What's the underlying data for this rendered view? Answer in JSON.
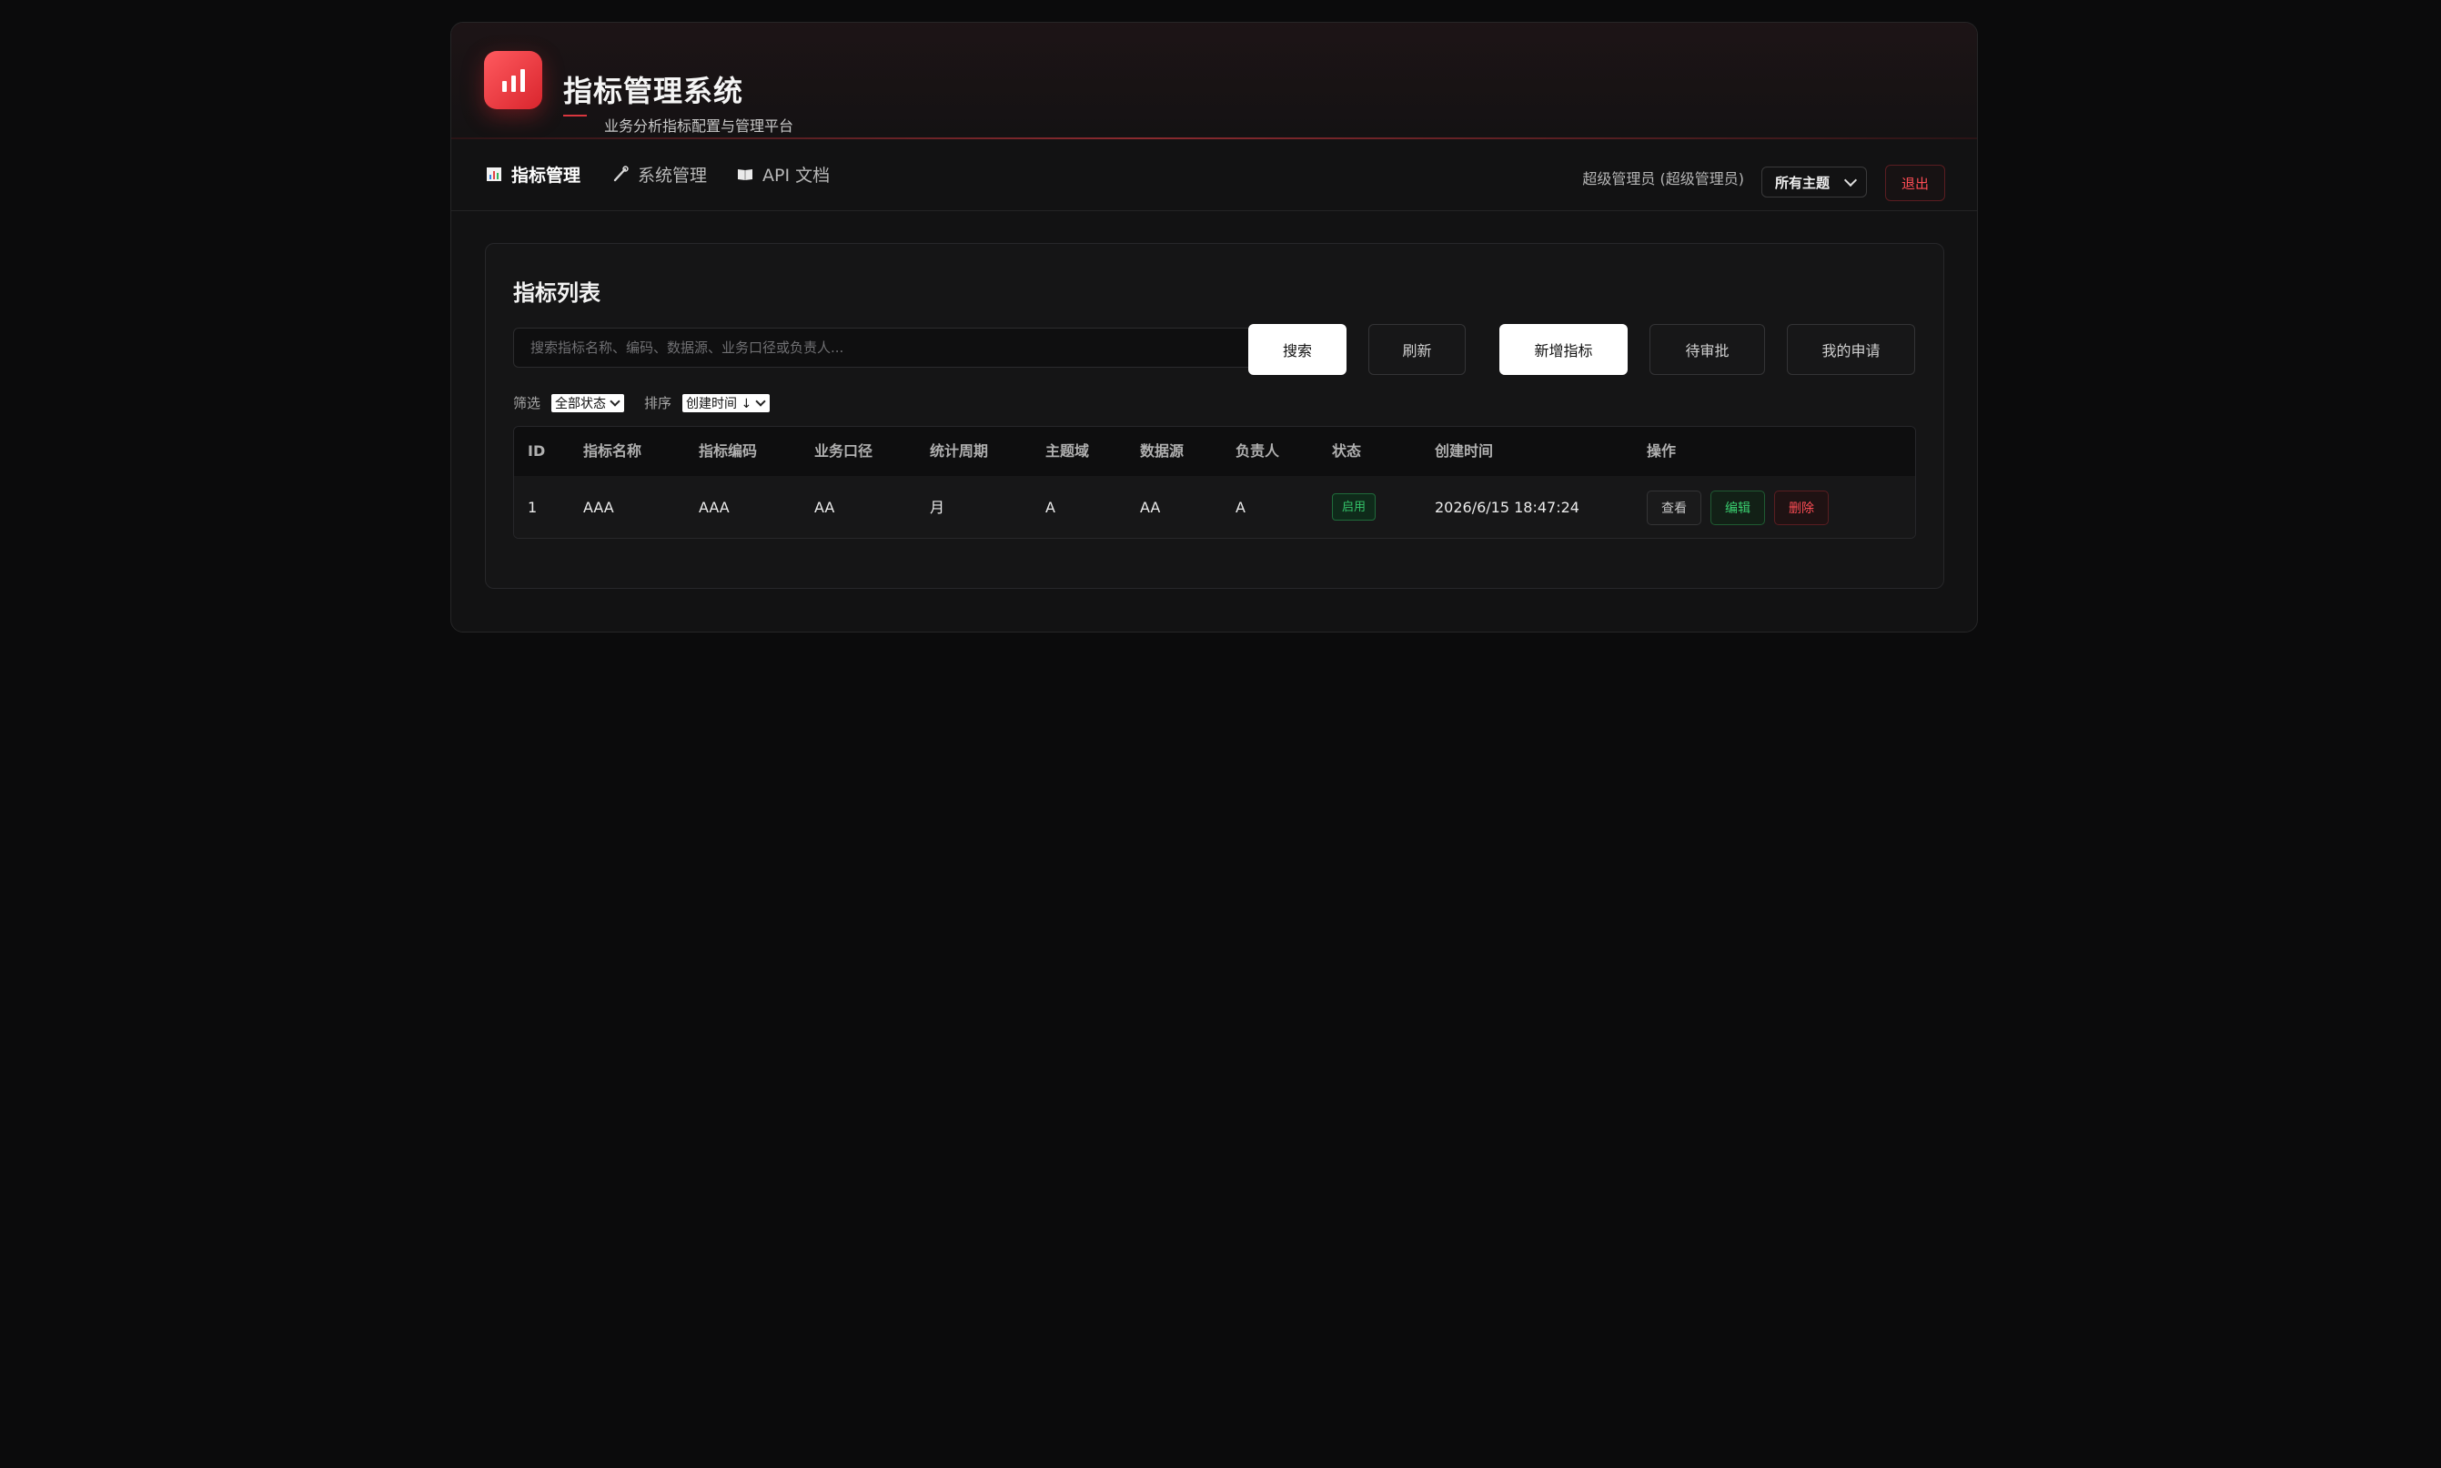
{
  "header": {
    "title": "指标管理系统",
    "subtitle": "业务分析指标配置与管理平台"
  },
  "nav": {
    "items": [
      {
        "label": "指标管理",
        "icon": "bar-chart-icon",
        "active": true
      },
      {
        "label": "系统管理",
        "icon": "wrench-icon",
        "active": false
      },
      {
        "label": "API 文档",
        "icon": "book-icon",
        "active": false
      }
    ],
    "user_label": "超级管理员 (超级管理员)",
    "theme_select": "所有主题",
    "logout_label": "退出"
  },
  "card": {
    "title": "指标列表",
    "search_placeholder": "搜索指标名称、编码、数据源、业务口径或负责人...",
    "buttons": {
      "search": "搜索",
      "refresh": "刷新",
      "add": "新增指标",
      "pending": "待审批",
      "my_requests": "我的申请"
    },
    "filter_label": "筛选",
    "filter_value": "全部状态",
    "sort_label": "排序",
    "sort_value": "创建时间 ↓"
  },
  "table": {
    "columns": [
      "ID",
      "指标名称",
      "指标编码",
      "业务口径",
      "统计周期",
      "主题域",
      "数据源",
      "负责人",
      "状态",
      "创建时间",
      "操作"
    ],
    "rows": [
      {
        "id": "1",
        "name": "AAA",
        "code": "AAA",
        "caliber": "AA",
        "period": "月",
        "domain": "A",
        "source": "AA",
        "owner": "A",
        "status": "启用",
        "created": "2026/6/15 18:47:24",
        "actions": {
          "view": "查看",
          "edit": "编辑",
          "delete": "删除"
        }
      }
    ]
  },
  "colors": {
    "accent_red": "#ff4d55",
    "status_green": "#34c46a",
    "background": "#0b0b0c"
  }
}
